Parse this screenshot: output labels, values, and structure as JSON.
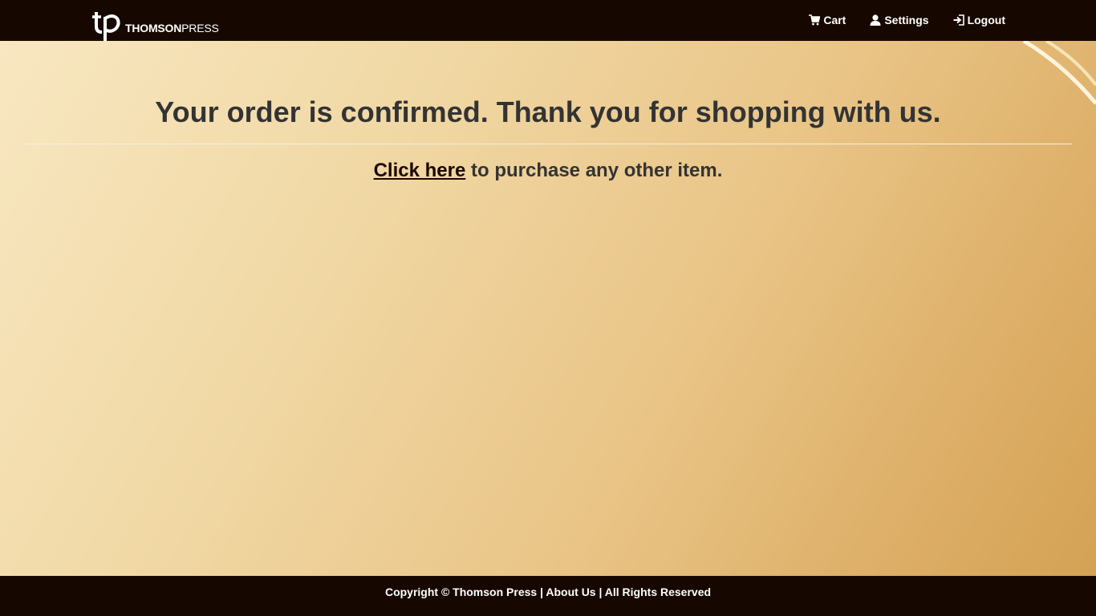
{
  "brand": {
    "name_bold": "THOMSON",
    "name_regular": "PRESS"
  },
  "nav": {
    "cart_label": "Cart",
    "settings_label": "Settings",
    "logout_label": "Logout"
  },
  "main": {
    "headline": "Your order is confirmed. Thank you for shopping with us.",
    "link_text": "Click here",
    "subline_text": " to purchase any other item."
  },
  "footer": {
    "copyright": "Copyright © Thomson Press",
    "sep1": " | ",
    "about": "About Us",
    "sep2": " | ",
    "rights": "All Rights Reserved"
  },
  "icons": {
    "logo": "tp-logo-icon",
    "cart": "shopping-cart-icon",
    "settings": "user-icon",
    "logout": "log-in-arrow-icon"
  },
  "colors": {
    "header_bg": "#160800",
    "footer_bg": "#160800",
    "text_dark": "#333333"
  }
}
